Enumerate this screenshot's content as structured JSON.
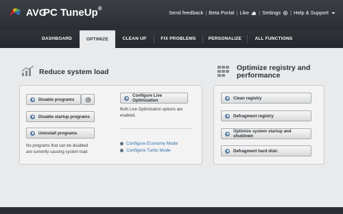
{
  "app": {
    "brand": "AVG",
    "product": "PC TuneUp",
    "reg_mark": "®"
  },
  "topmenu": {
    "send_feedback": "Send feedback",
    "beta_portal": "Beta Portal",
    "like": "Like",
    "settings": "Settings",
    "help_support": "Help & Support"
  },
  "tabs": [
    {
      "label": "DASHBOARD",
      "active": false
    },
    {
      "label": "OPTIMIZE",
      "active": true
    },
    {
      "label": "CLEAN UP",
      "active": false
    },
    {
      "label": "FIX PROBLEMS",
      "active": false
    },
    {
      "label": "PERSONALIZE",
      "active": false
    },
    {
      "label": "ALL FUNCTIONS",
      "active": false
    }
  ],
  "reduce": {
    "title": "Reduce system load",
    "disable_programs": "Disable programs",
    "disable_startup": "Disable startup programs",
    "uninstall_programs": "Uninstall programs",
    "note_line1": "No programs that can be disabled",
    "note_line2": "are currently causing system load.",
    "configure_live": "Configure Live Optimization",
    "live_note_line1": "Both Live Optimization options are",
    "live_note_line2": "enabled.",
    "economy_mode": "Configure Economy Mode",
    "turbo_mode": "Configure Turbo Mode"
  },
  "registry": {
    "title_line1": "Optimize registry and",
    "title_line2": "performance",
    "clean_registry": "Clean registry",
    "defragment_registry": "Defragment registry",
    "optimize_startup": "Optimize system startup and shutdown",
    "defragment_disk": "Defragment hard disk:"
  },
  "colors": {
    "titlebar": "#2f3439",
    "accent_blue": "#5d7fa4",
    "link_blue": "#2e6ea6",
    "logo_red": "#d8232a",
    "logo_green": "#6aa84f",
    "logo_yellow": "#f0c419",
    "logo_blue": "#2f6db5"
  }
}
